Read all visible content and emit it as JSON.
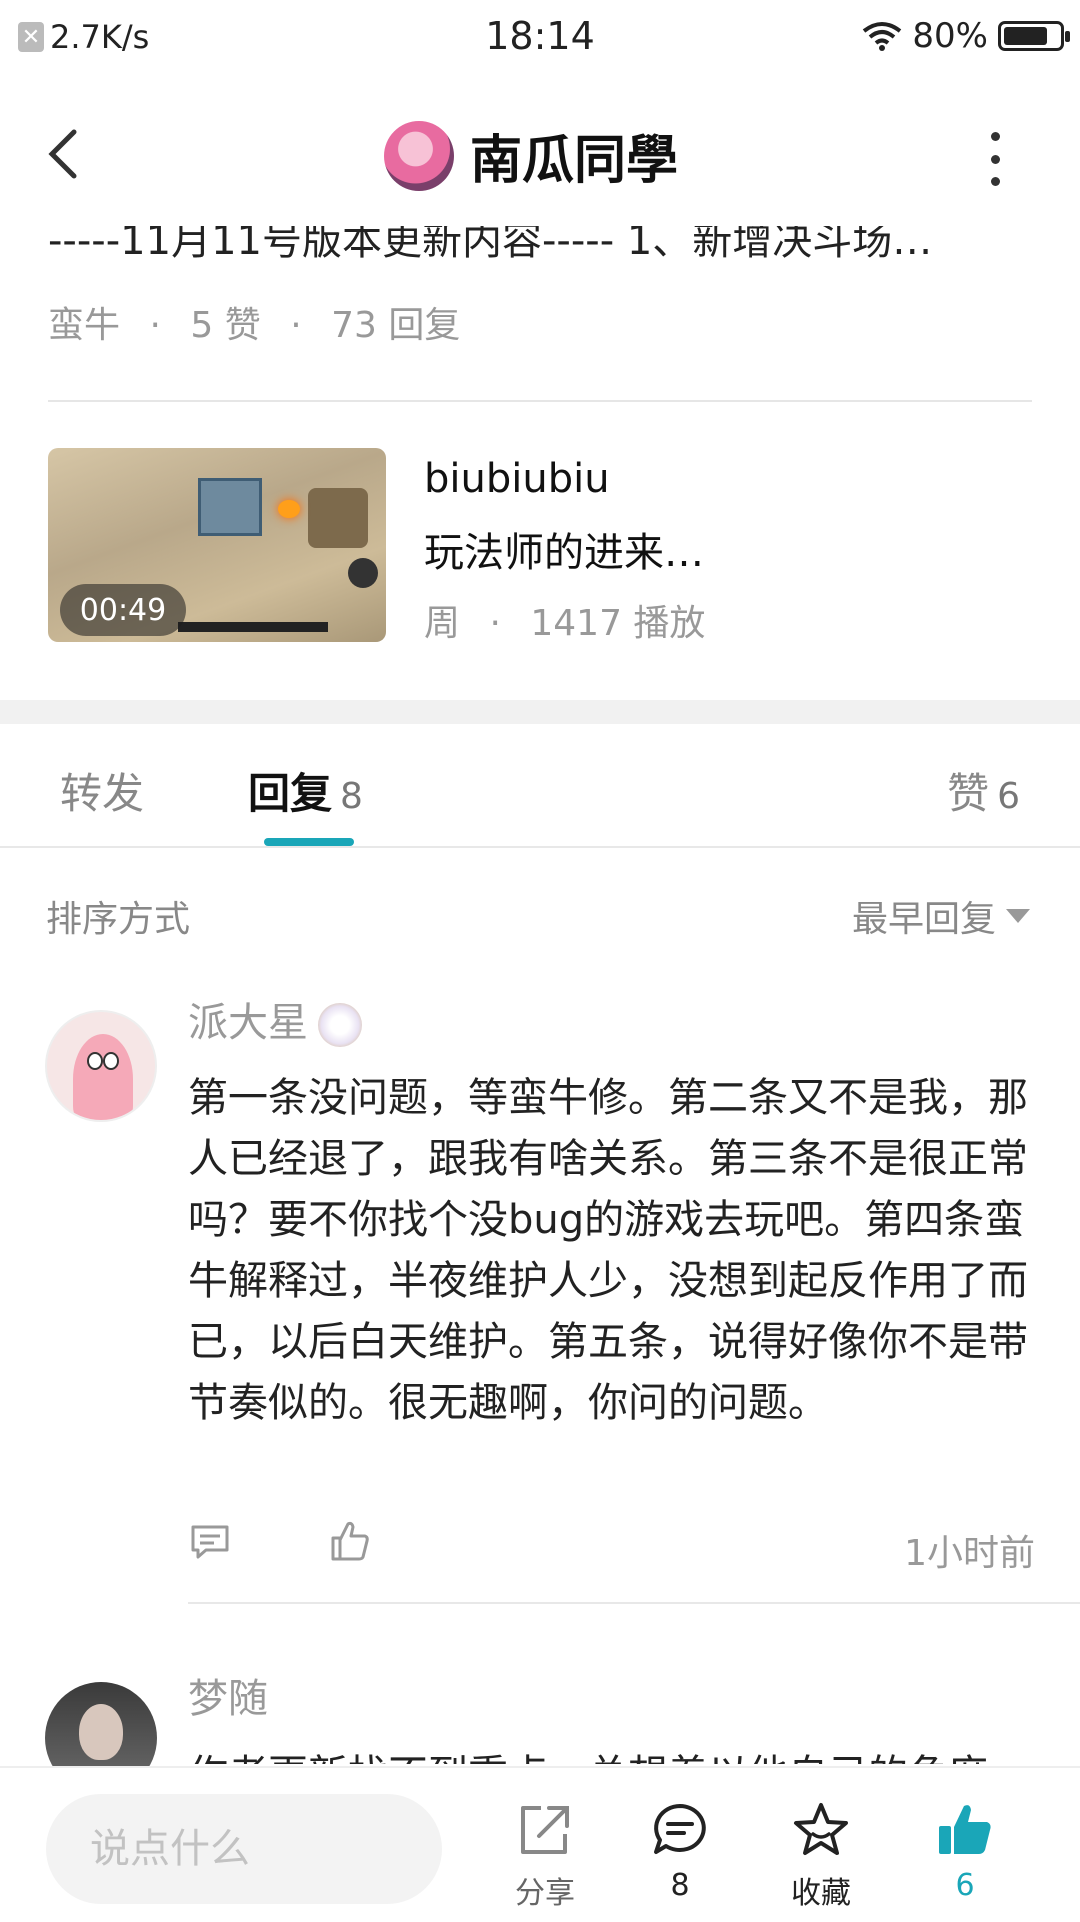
{
  "status_bar": {
    "net_speed": "2.7K/s",
    "time": "18:14",
    "battery": "80%",
    "battery_level": 0.8
  },
  "header": {
    "title": "南瓜同學"
  },
  "prev_post": {
    "clipped_text": "-----11月11号版本更新内容----- 1、新增决斗场…",
    "author": "蛮牛",
    "likes": "5 赞",
    "replies": "73 回复",
    "sep": "·"
  },
  "video": {
    "duration": "00:49",
    "author": "biubiubiu",
    "title": "玩法师的进来…",
    "meta_author": "周",
    "plays": "1417 播放"
  },
  "tabs": {
    "forward": "转发",
    "reply": "回复",
    "reply_count": "8",
    "like": "赞",
    "like_count": "6"
  },
  "sort": {
    "label": "排序方式",
    "value": "最早回复"
  },
  "comments": [
    {
      "name": "派大星",
      "text": "第一条没问题，等蛮牛修。第二条又不是我，那人已经退了，跟我有啥关系。第三条不是很正常吗？要不你找个没bug的游戏去玩吧。第四条蛮牛解释过，半夜维护人少，没想到起反作用了而已，以后白天维护。第五条，说得好像你不是带节奏似的。很无趣啊，你问的问题。",
      "time": "1小时前"
    },
    {
      "name": "梦随",
      "clipped_text": "作者更新找不到重点，总想着以他自己的角度"
    }
  ],
  "bottom_bar": {
    "input_placeholder": "说点什么",
    "share": "分享",
    "comment_count": "8",
    "favorite": "收藏",
    "like_count": "6",
    "accent_color": "#1aa6b8"
  }
}
